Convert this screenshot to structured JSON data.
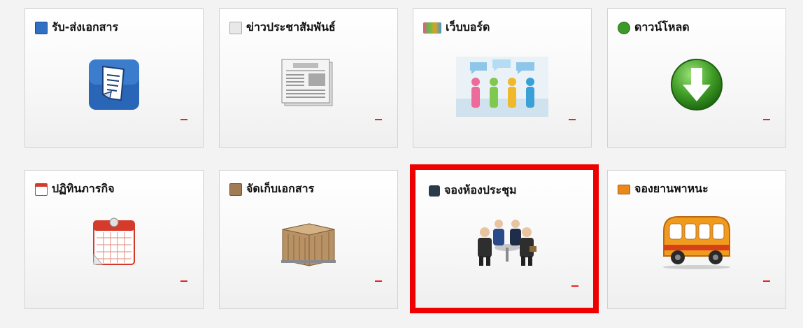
{
  "tiles": [
    {
      "id": "receive-docs",
      "title": "รับ-ส่งเอกสาร",
      "icon": "document-icon",
      "highlighted": false
    },
    {
      "id": "pr-news",
      "title": "ข่าวประชาสัมพันธ์",
      "icon": "newspaper-icon",
      "highlighted": false
    },
    {
      "id": "webboard",
      "title": "เว็บบอร์ด",
      "icon": "webboard-people-icon",
      "highlighted": false
    },
    {
      "id": "download",
      "title": "ดาวน์โหลด",
      "icon": "download-arrow-icon",
      "highlighted": false
    },
    {
      "id": "calendar",
      "title": "ปฏิทินภารกิจ",
      "icon": "calendar-icon",
      "highlighted": false
    },
    {
      "id": "archive",
      "title": "จัดเก็บเอกสาร",
      "icon": "archive-boxes-icon",
      "highlighted": false
    },
    {
      "id": "meeting-room",
      "title": "จองห้องประชุม",
      "icon": "meeting-people-icon",
      "highlighted": true
    },
    {
      "id": "vehicle",
      "title": "จองยานพาหนะ",
      "icon": "bus-icon",
      "highlighted": false
    }
  ],
  "colors": {
    "highlight": "#ee0000",
    "dash": "#ee2222"
  }
}
